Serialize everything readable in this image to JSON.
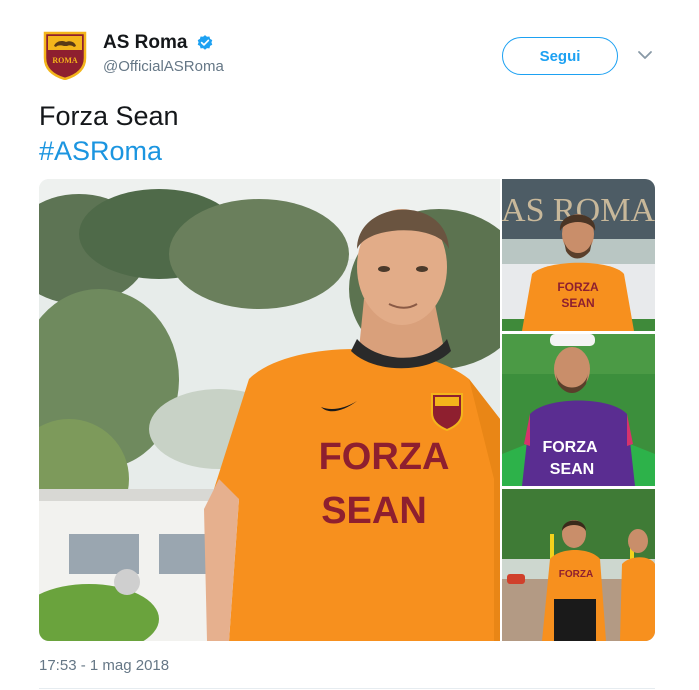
{
  "account": {
    "name": "AS Roma",
    "handle": "@OfficialASRoma",
    "logo_text": "ROMA",
    "verified": true
  },
  "actions": {
    "follow_label": "Segui"
  },
  "tweet": {
    "text": "Forza Sean",
    "hashtag": "#ASRoma",
    "timestamp": "17:53 - 1 mag 2018"
  },
  "photos": {
    "main_shirt_line1": "FORZA",
    "main_shirt_line2": "SEAN",
    "p1_shirt_line1": "FORZA",
    "p1_shirt_line2": "SEAN",
    "p1_banner": "AS ROMA",
    "p2_shirt_line1": "FORZA",
    "p2_shirt_line2": "SEAN",
    "p3_shirt": "FORZA"
  },
  "colors": {
    "accent": "#1da1f2",
    "hashtag": "#1b95e0",
    "secondary_text": "#657786",
    "roma_orange": "#f7901e",
    "roma_maroon": "#8e1f2f",
    "keeper_purple": "#5a2d91"
  }
}
